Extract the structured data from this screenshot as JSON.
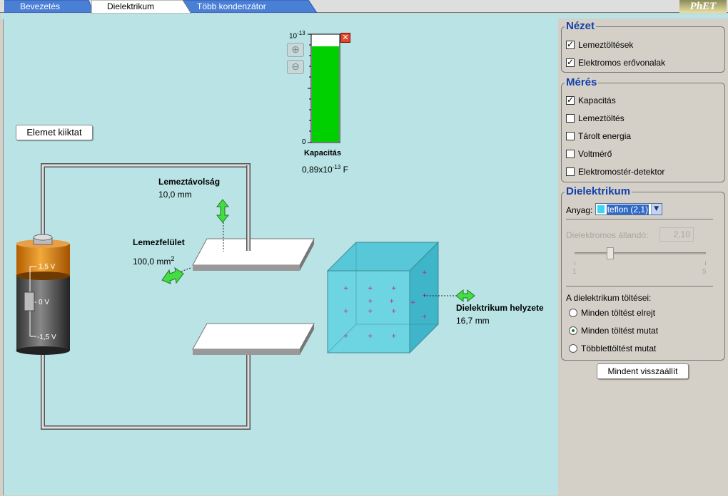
{
  "tabs": [
    {
      "label": "Bevezetés"
    },
    {
      "label": "Dielektrikum"
    },
    {
      "label": "Több kondenzátor"
    }
  ],
  "logo_text": "PhET",
  "battery_button": "Elemet kiiktat",
  "meter": {
    "scale_top": "10",
    "scale_top_exp": "-13",
    "scale_bottom": "0",
    "label": "Kapacitás",
    "value_mantissa": "0,89x10",
    "value_exp": "-13",
    "value_unit": "F",
    "fill_fraction": 0.89
  },
  "plate_separation": {
    "label": "Lemeztávolság",
    "value": "10,0 mm"
  },
  "plate_area": {
    "label": "Lemezfelület",
    "value": "100,0 mm",
    "exp": "2"
  },
  "dielectric_offset": {
    "label": "Dielektrikum helyzete",
    "value": "16,7 mm"
  },
  "battery": {
    "top": "1,5 V",
    "mid": "0 V",
    "bottom": "-1,5 V"
  },
  "panel": {
    "view": {
      "title": "Nézet",
      "items": [
        {
          "label": "Lemeztöltések",
          "checked": true
        },
        {
          "label": "Elektromos erővonalak",
          "checked": true
        }
      ]
    },
    "measure": {
      "title": "Mérés",
      "items": [
        {
          "label": "Kapacitás",
          "checked": true
        },
        {
          "label": "Lemeztöltés",
          "checked": false
        },
        {
          "label": "Tárolt energia",
          "checked": false
        },
        {
          "label": "Voltmérő",
          "checked": false
        },
        {
          "label": "Elektromostér-detektor",
          "checked": false
        }
      ]
    },
    "dielectric": {
      "title": "Dielektrikum",
      "material_label": "Anyag:",
      "material_value": "teflon (2,1)",
      "material_color": "#3cd6f5",
      "constant_label": "Dielektromos állandó:",
      "constant_value": "2,10",
      "slider_min": "1",
      "slider_max": "5",
      "slider_value": 2.1,
      "charges_label": "A dielektrikum töltései:",
      "options": [
        {
          "label": "Minden töltést elrejt",
          "selected": false
        },
        {
          "label": "Minden töltést mutat",
          "selected": true
        },
        {
          "label": "Többlettöltést mutat",
          "selected": false
        }
      ]
    },
    "reset": "Mindent visszaállít"
  }
}
